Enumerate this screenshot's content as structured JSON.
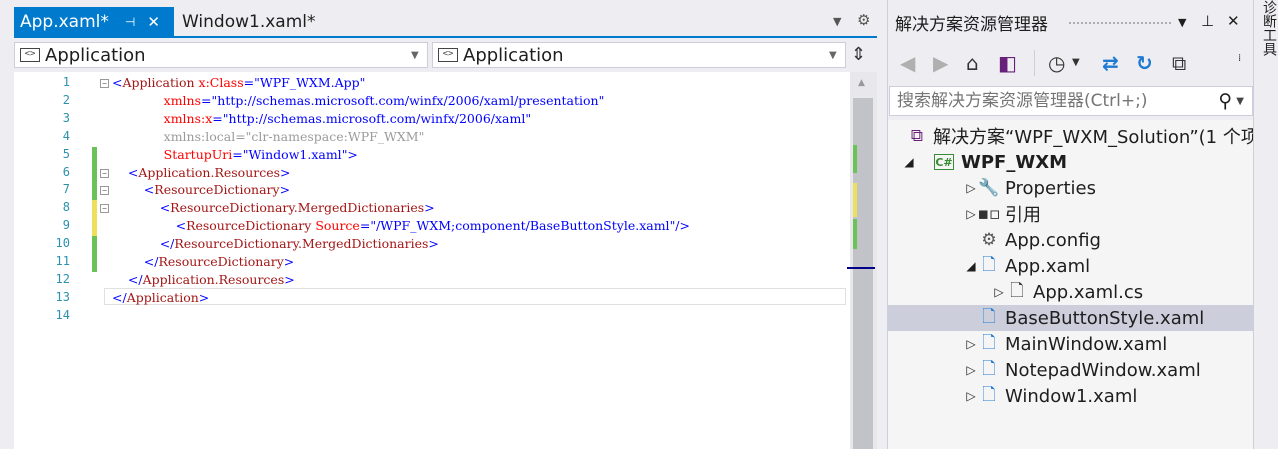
{
  "editor": {
    "tabs": [
      {
        "label": "App.xaml*",
        "pin": "⊣",
        "close": "✕"
      },
      {
        "label": "Window1.xaml*"
      }
    ],
    "nav_left": "Application",
    "nav_right": "Application",
    "combo_icon": "<>",
    "line_numbers": [
      "1",
      "2",
      "3",
      "4",
      "5",
      "6",
      "7",
      "8",
      "9",
      "10",
      "11",
      "12",
      "13",
      "14"
    ],
    "lines": [
      {
        "indent": "",
        "parts": [
          {
            "c": "t-punct",
            "t": "<"
          },
          {
            "c": "t-tag",
            "t": "Application"
          },
          {
            "c": "t-attr",
            "t": " x:Class"
          },
          {
            "c": "t-punct",
            "t": "=\""
          },
          {
            "c": "t-val",
            "t": "WPF_WXM.App"
          },
          {
            "c": "t-punct",
            "t": "\""
          }
        ]
      },
      {
        "indent": "             ",
        "parts": [
          {
            "c": "t-attr",
            "t": "xmlns"
          },
          {
            "c": "t-punct",
            "t": "=\""
          },
          {
            "c": "t-val",
            "t": "http://schemas.microsoft.com/winfx/2006/xaml/presentation"
          },
          {
            "c": "t-punct",
            "t": "\""
          }
        ]
      },
      {
        "indent": "             ",
        "parts": [
          {
            "c": "t-attr",
            "t": "xmlns:x"
          },
          {
            "c": "t-punct",
            "t": "=\""
          },
          {
            "c": "t-val",
            "t": "http://schemas.microsoft.com/winfx/2006/xaml"
          },
          {
            "c": "t-punct",
            "t": "\""
          }
        ]
      },
      {
        "indent": "             ",
        "parts": [
          {
            "c": "t-faint",
            "t": "xmlns:local=\"clr-namespace:WPF_WXM\""
          }
        ]
      },
      {
        "indent": "             ",
        "parts": [
          {
            "c": "t-attr",
            "t": "StartupUri"
          },
          {
            "c": "t-punct",
            "t": "=\""
          },
          {
            "c": "t-val",
            "t": "Window1.xaml"
          },
          {
            "c": "t-punct",
            "t": "\">"
          }
        ]
      },
      {
        "indent": "    ",
        "parts": [
          {
            "c": "t-punct",
            "t": "<"
          },
          {
            "c": "t-tag",
            "t": "Application.Resources"
          },
          {
            "c": "t-punct",
            "t": ">"
          }
        ]
      },
      {
        "indent": "        ",
        "parts": [
          {
            "c": "t-punct",
            "t": "<"
          },
          {
            "c": "t-tag",
            "t": "ResourceDictionary"
          },
          {
            "c": "t-punct",
            "t": ">"
          }
        ]
      },
      {
        "indent": "            ",
        "parts": [
          {
            "c": "t-punct",
            "t": "<"
          },
          {
            "c": "t-tag",
            "t": "ResourceDictionary.MergedDictionaries"
          },
          {
            "c": "t-punct",
            "t": ">"
          }
        ]
      },
      {
        "indent": "                ",
        "parts": [
          {
            "c": "t-punct",
            "t": "<"
          },
          {
            "c": "t-tag",
            "t": "ResourceDictionary"
          },
          {
            "c": "t-attr",
            "t": " Source"
          },
          {
            "c": "t-punct",
            "t": "=\""
          },
          {
            "c": "t-val",
            "t": "/WPF_WXM;component/BaseButtonStyle.xaml"
          },
          {
            "c": "t-punct",
            "t": "\"/>"
          }
        ]
      },
      {
        "indent": "            ",
        "parts": [
          {
            "c": "t-punct",
            "t": "</"
          },
          {
            "c": "t-tag",
            "t": "ResourceDictionary.MergedDictionaries"
          },
          {
            "c": "t-punct",
            "t": ">"
          }
        ]
      },
      {
        "indent": "        ",
        "parts": [
          {
            "c": "t-punct",
            "t": "</"
          },
          {
            "c": "t-tag",
            "t": "ResourceDictionary"
          },
          {
            "c": "t-punct",
            "t": ">"
          }
        ]
      },
      {
        "indent": "    ",
        "parts": [
          {
            "c": "t-punct",
            "t": "</"
          },
          {
            "c": "t-tag",
            "t": "Application.Resources"
          },
          {
            "c": "t-punct",
            "t": ">"
          }
        ]
      },
      {
        "indent": "",
        "parts": [
          {
            "c": "t-punct",
            "t": "</"
          },
          {
            "c": "t-tag",
            "t": "Application"
          },
          {
            "c": "t-punct",
            "t": ">"
          }
        ]
      },
      {
        "indent": "",
        "parts": []
      }
    ],
    "colors": {
      "accent": "#007acc",
      "changed_saved": "#6ac259",
      "changed_unsaved": "#efe05b"
    }
  },
  "solution_explorer": {
    "title": "解决方案资源管理器",
    "search_placeholder": "搜索解决方案资源管理器(Ctrl+;)",
    "side_tab": "诊断工具",
    "tree": [
      {
        "label": "解决方案“WPF_WXM_Solution”(1 个项",
        "icon": "solution-icon",
        "expander": ""
      },
      {
        "label": "WPF_WXM",
        "icon": "csharp-project-icon",
        "expander": "◢",
        "bold": true
      },
      {
        "label": "Properties",
        "icon": "wrench-icon",
        "expander": "▷"
      },
      {
        "label": "引用",
        "icon": "references-icon",
        "expander": "▷"
      },
      {
        "label": "App.config",
        "icon": "config-file-icon",
        "expander": ""
      },
      {
        "label": "App.xaml",
        "icon": "xaml-file-icon",
        "expander": "◢"
      },
      {
        "label": "App.xaml.cs",
        "icon": "cs-file-icon",
        "expander": "▷"
      },
      {
        "label": "BaseButtonStyle.xaml",
        "icon": "xaml-file-icon",
        "expander": "",
        "selected": true
      },
      {
        "label": "MainWindow.xaml",
        "icon": "xaml-file-icon",
        "expander": "▷"
      },
      {
        "label": "NotepadWindow.xaml",
        "icon": "xaml-file-icon",
        "expander": "▷"
      },
      {
        "label": "Window1.xaml",
        "icon": "xaml-file-icon",
        "expander": "▷"
      }
    ]
  }
}
